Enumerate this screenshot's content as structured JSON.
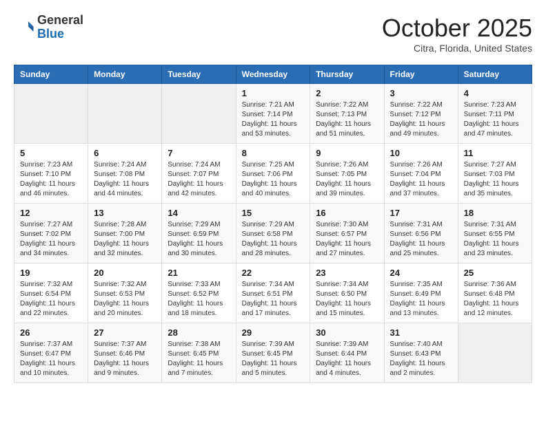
{
  "header": {
    "logo_general": "General",
    "logo_blue": "Blue",
    "month_title": "October 2025",
    "location": "Citra, Florida, United States"
  },
  "weekdays": [
    "Sunday",
    "Monday",
    "Tuesday",
    "Wednesday",
    "Thursday",
    "Friday",
    "Saturday"
  ],
  "weeks": [
    [
      {
        "day": null,
        "info": null
      },
      {
        "day": null,
        "info": null
      },
      {
        "day": null,
        "info": null
      },
      {
        "day": "1",
        "info": "Sunrise: 7:21 AM\nSunset: 7:14 PM\nDaylight: 11 hours\nand 53 minutes."
      },
      {
        "day": "2",
        "info": "Sunrise: 7:22 AM\nSunset: 7:13 PM\nDaylight: 11 hours\nand 51 minutes."
      },
      {
        "day": "3",
        "info": "Sunrise: 7:22 AM\nSunset: 7:12 PM\nDaylight: 11 hours\nand 49 minutes."
      },
      {
        "day": "4",
        "info": "Sunrise: 7:23 AM\nSunset: 7:11 PM\nDaylight: 11 hours\nand 47 minutes."
      }
    ],
    [
      {
        "day": "5",
        "info": "Sunrise: 7:23 AM\nSunset: 7:10 PM\nDaylight: 11 hours\nand 46 minutes."
      },
      {
        "day": "6",
        "info": "Sunrise: 7:24 AM\nSunset: 7:08 PM\nDaylight: 11 hours\nand 44 minutes."
      },
      {
        "day": "7",
        "info": "Sunrise: 7:24 AM\nSunset: 7:07 PM\nDaylight: 11 hours\nand 42 minutes."
      },
      {
        "day": "8",
        "info": "Sunrise: 7:25 AM\nSunset: 7:06 PM\nDaylight: 11 hours\nand 40 minutes."
      },
      {
        "day": "9",
        "info": "Sunrise: 7:26 AM\nSunset: 7:05 PM\nDaylight: 11 hours\nand 39 minutes."
      },
      {
        "day": "10",
        "info": "Sunrise: 7:26 AM\nSunset: 7:04 PM\nDaylight: 11 hours\nand 37 minutes."
      },
      {
        "day": "11",
        "info": "Sunrise: 7:27 AM\nSunset: 7:03 PM\nDaylight: 11 hours\nand 35 minutes."
      }
    ],
    [
      {
        "day": "12",
        "info": "Sunrise: 7:27 AM\nSunset: 7:02 PM\nDaylight: 11 hours\nand 34 minutes."
      },
      {
        "day": "13",
        "info": "Sunrise: 7:28 AM\nSunset: 7:00 PM\nDaylight: 11 hours\nand 32 minutes."
      },
      {
        "day": "14",
        "info": "Sunrise: 7:29 AM\nSunset: 6:59 PM\nDaylight: 11 hours\nand 30 minutes."
      },
      {
        "day": "15",
        "info": "Sunrise: 7:29 AM\nSunset: 6:58 PM\nDaylight: 11 hours\nand 28 minutes."
      },
      {
        "day": "16",
        "info": "Sunrise: 7:30 AM\nSunset: 6:57 PM\nDaylight: 11 hours\nand 27 minutes."
      },
      {
        "day": "17",
        "info": "Sunrise: 7:31 AM\nSunset: 6:56 PM\nDaylight: 11 hours\nand 25 minutes."
      },
      {
        "day": "18",
        "info": "Sunrise: 7:31 AM\nSunset: 6:55 PM\nDaylight: 11 hours\nand 23 minutes."
      }
    ],
    [
      {
        "day": "19",
        "info": "Sunrise: 7:32 AM\nSunset: 6:54 PM\nDaylight: 11 hours\nand 22 minutes."
      },
      {
        "day": "20",
        "info": "Sunrise: 7:32 AM\nSunset: 6:53 PM\nDaylight: 11 hours\nand 20 minutes."
      },
      {
        "day": "21",
        "info": "Sunrise: 7:33 AM\nSunset: 6:52 PM\nDaylight: 11 hours\nand 18 minutes."
      },
      {
        "day": "22",
        "info": "Sunrise: 7:34 AM\nSunset: 6:51 PM\nDaylight: 11 hours\nand 17 minutes."
      },
      {
        "day": "23",
        "info": "Sunrise: 7:34 AM\nSunset: 6:50 PM\nDaylight: 11 hours\nand 15 minutes."
      },
      {
        "day": "24",
        "info": "Sunrise: 7:35 AM\nSunset: 6:49 PM\nDaylight: 11 hours\nand 13 minutes."
      },
      {
        "day": "25",
        "info": "Sunrise: 7:36 AM\nSunset: 6:48 PM\nDaylight: 11 hours\nand 12 minutes."
      }
    ],
    [
      {
        "day": "26",
        "info": "Sunrise: 7:37 AM\nSunset: 6:47 PM\nDaylight: 11 hours\nand 10 minutes."
      },
      {
        "day": "27",
        "info": "Sunrise: 7:37 AM\nSunset: 6:46 PM\nDaylight: 11 hours\nand 9 minutes."
      },
      {
        "day": "28",
        "info": "Sunrise: 7:38 AM\nSunset: 6:45 PM\nDaylight: 11 hours\nand 7 minutes."
      },
      {
        "day": "29",
        "info": "Sunrise: 7:39 AM\nSunset: 6:45 PM\nDaylight: 11 hours\nand 5 minutes."
      },
      {
        "day": "30",
        "info": "Sunrise: 7:39 AM\nSunset: 6:44 PM\nDaylight: 11 hours\nand 4 minutes."
      },
      {
        "day": "31",
        "info": "Sunrise: 7:40 AM\nSunset: 6:43 PM\nDaylight: 11 hours\nand 2 minutes."
      },
      {
        "day": null,
        "info": null
      }
    ]
  ]
}
